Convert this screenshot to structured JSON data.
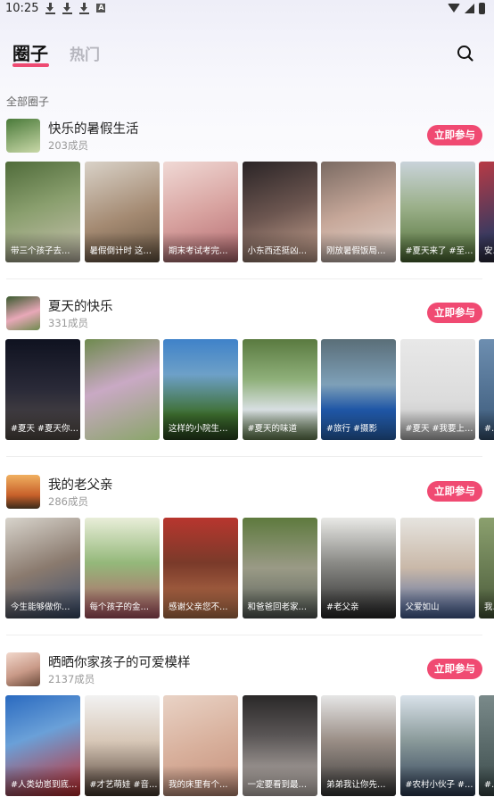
{
  "status": {
    "time": "10:25",
    "a_label": "A"
  },
  "header": {
    "active_tab": "圈子",
    "inactive_tab": "热门"
  },
  "section_label": "全部圈子",
  "join_label": "立即参与",
  "colors": {
    "accent": "#f04a72",
    "underline": "#ee4a72"
  },
  "circles": [
    {
      "title": "快乐的暑假生活",
      "members": "203成员",
      "thumbs": [
        {
          "caption": "带三个孩子去…",
          "bg": "linear-gradient(160deg,#4f6b3a 0%,#8a9f6e 45%,#c9c2b0 100%)"
        },
        {
          "caption": "暑假倒计时 这…",
          "bg": "linear-gradient(160deg,#d9d2c8 0%,#a48a72 55%,#6b5844 100%)"
        },
        {
          "caption": "期末考试考完…",
          "bg": "linear-gradient(160deg,#f0d9d5 0%,#d8a3a0 50%,#b46a70 100%)"
        },
        {
          "caption": "小东西还挺凶…",
          "bg": "linear-gradient(160deg,#2a2426 0%,#6c5650 50%,#c9a592 100%)"
        },
        {
          "caption": "刚放暑假饭局…",
          "bg": "linear-gradient(160deg,#7a6a62 0%,#c7a89a 50%,#e3d6cf 100%)"
        },
        {
          "caption": "#夏天来了 #至…",
          "bg": "linear-gradient(180deg,#c9d3da 0%,#9bb08a 45%,#4f6e35 100%)"
        },
        {
          "caption": "安…",
          "bg": "linear-gradient(160deg,#b83a45 0%,#3b3a60 60%,#222 100%)"
        }
      ]
    },
    {
      "title": "夏天的快乐",
      "members": "331成员",
      "thumbs": [
        {
          "caption": "#夏天 #夏天你…",
          "bg": "linear-gradient(180deg,#0f1220 0%,#2a2a38 50%,#58504a 100%)"
        },
        {
          "caption": "",
          "bg": "linear-gradient(160deg,#6e8a4e 0%,#c9a9c4 45%,#8aa56a 100%)"
        },
        {
          "caption": "这样的小院生…",
          "bg": "linear-gradient(180deg,#3f82c9 0%,#6da0c8 35%,#3d6e2e 75%,#2c4a22 100%)"
        },
        {
          "caption": "#夏天的味道",
          "bg": "linear-gradient(180deg,#5a7a40 0%,#8fb07a 40%,#d8dfe2 70%,#6e8a58 100%)"
        },
        {
          "caption": "#旅行 #摄影",
          "bg": "linear-gradient(180deg,#5a6e78 0%,#7ea0b8 45%,#1f56a6 70%,#2b6cc0 100%)"
        },
        {
          "caption": "#夏天 #我要上…",
          "bg": "linear-gradient(180deg,#e8e8e8 0%,#dcdcdc 60%,#bfbfbf 100%)"
        },
        {
          "caption": "#…",
          "bg": "linear-gradient(180deg,#6d8eb0 0%,#3a5878 100%)"
        }
      ]
    },
    {
      "title": "我的老父亲",
      "members": "286成员",
      "thumbs": [
        {
          "caption": "今生能够做你…",
          "bg": "linear-gradient(160deg,#d8d4cc 0%,#8a7a6e 50%,#3a4e6e 100%)"
        },
        {
          "caption": "每个孩子的金…",
          "bg": "linear-gradient(180deg,#e9eed9 0%,#94b87a 45%,#b85a6a 100%)"
        },
        {
          "caption": "感谢父亲您不…",
          "bg": "linear-gradient(180deg,#b8362e 0%,#7a3a2a 45%,#c07a50 100%)"
        },
        {
          "caption": "和爸爸回老家…",
          "bg": "linear-gradient(180deg,#5e7a3e 0%,#9a9a86 50%,#58605a 100%)"
        },
        {
          "caption": "#老父亲",
          "bg": "linear-gradient(180deg,#e9e9e6 0%,#8a8a86 45%,#2a2a2a 100%)"
        },
        {
          "caption": "父爱如山",
          "bg": "linear-gradient(180deg,#e6e4df 0%,#c9b8a8 50%,#4a66a0 100%)"
        },
        {
          "caption": "我…",
          "bg": "linear-gradient(180deg,#8ba06e 0%,#4a5a3a 100%)"
        }
      ]
    },
    {
      "title": "晒晒你家孩子的可爱模样",
      "members": "2137成员",
      "thumbs": [
        {
          "caption": "#人类幼崽到底…",
          "bg": "linear-gradient(160deg,#2a6ac0 0%,#6aa0d8 40%,#c82a2a 100%)"
        },
        {
          "caption": "#才艺萌娃 #音…",
          "bg": "linear-gradient(180deg,#f2f2f2 0%,#d8c8b8 45%,#4a3a30 100%)"
        },
        {
          "caption": "我的床里有个…",
          "bg": "linear-gradient(160deg,#e9d3c6 0%,#d8b09c 50%,#c48f7a 100%)"
        },
        {
          "caption": "一定要看到最…",
          "bg": "linear-gradient(180deg,#2a2828 0%,#5a5656 40%,#c9c0ba 100%)"
        },
        {
          "caption": "弟弟我让你先…",
          "bg": "linear-gradient(180deg,#e6e6e6 0%,#9a8e86 45%,#3a3a3a 100%)"
        },
        {
          "caption": "#农村小伙子 #…",
          "bg": "linear-gradient(180deg,#d9e2ea 0%,#8a9a9a 45%,#2e3e56 100%)"
        },
        {
          "caption": "#…",
          "bg": "linear-gradient(180deg,#7a8a8a 0%,#3a4a4a 100%)"
        }
      ]
    }
  ]
}
